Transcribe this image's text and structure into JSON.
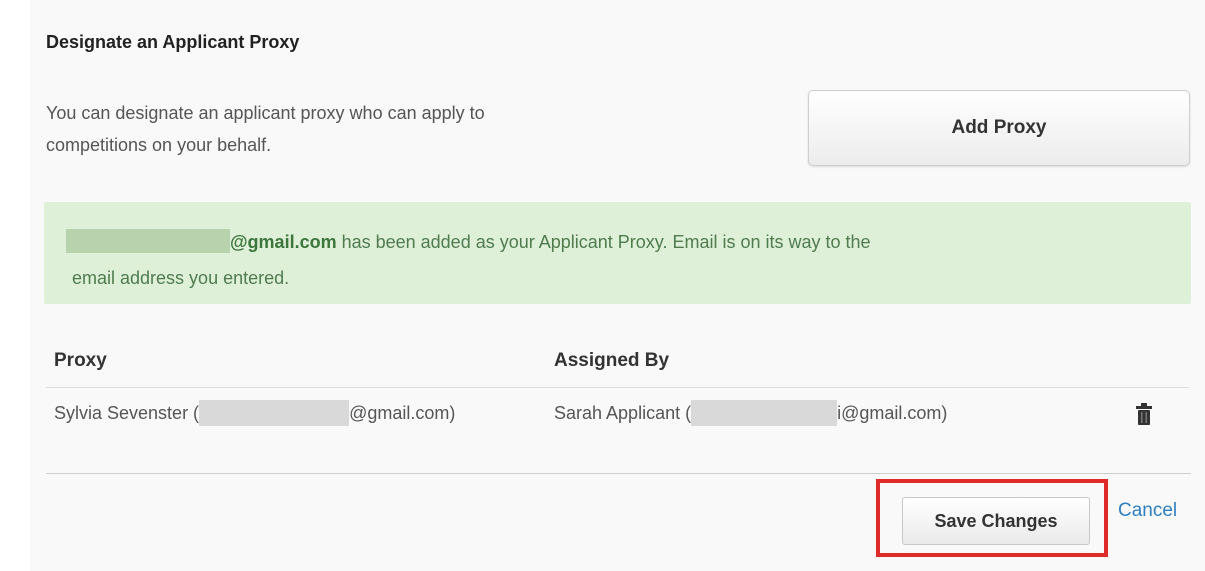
{
  "section": {
    "title": "Designate an Applicant Proxy",
    "description_line1": "You can designate an applicant proxy who can apply to",
    "description_line2": "competitions on your behalf.",
    "add_proxy_label": "Add Proxy"
  },
  "alert": {
    "email_suffix": "@gmail.com",
    "message_rest": " has been added as your Applicant Proxy. Email is on its way to the",
    "message_line2": "email address you entered."
  },
  "table": {
    "headers": {
      "proxy": "Proxy",
      "assigned_by": "Assigned By"
    },
    "rows": [
      {
        "proxy_name": "Sylvia Sevenster (",
        "proxy_email_suffix": "@gmail.com)",
        "assigned_name": "Sarah Applicant (",
        "assigned_email_suffix": "i@gmail.com)",
        "action_icon": "trash-icon"
      }
    ]
  },
  "footer": {
    "save_label": "Save Changes",
    "cancel_label": "Cancel"
  },
  "colors": {
    "alert_bg": "#dff0d8",
    "alert_text": "#3c763d",
    "highlight": "#e02b2b",
    "link": "#2f7fc0"
  }
}
